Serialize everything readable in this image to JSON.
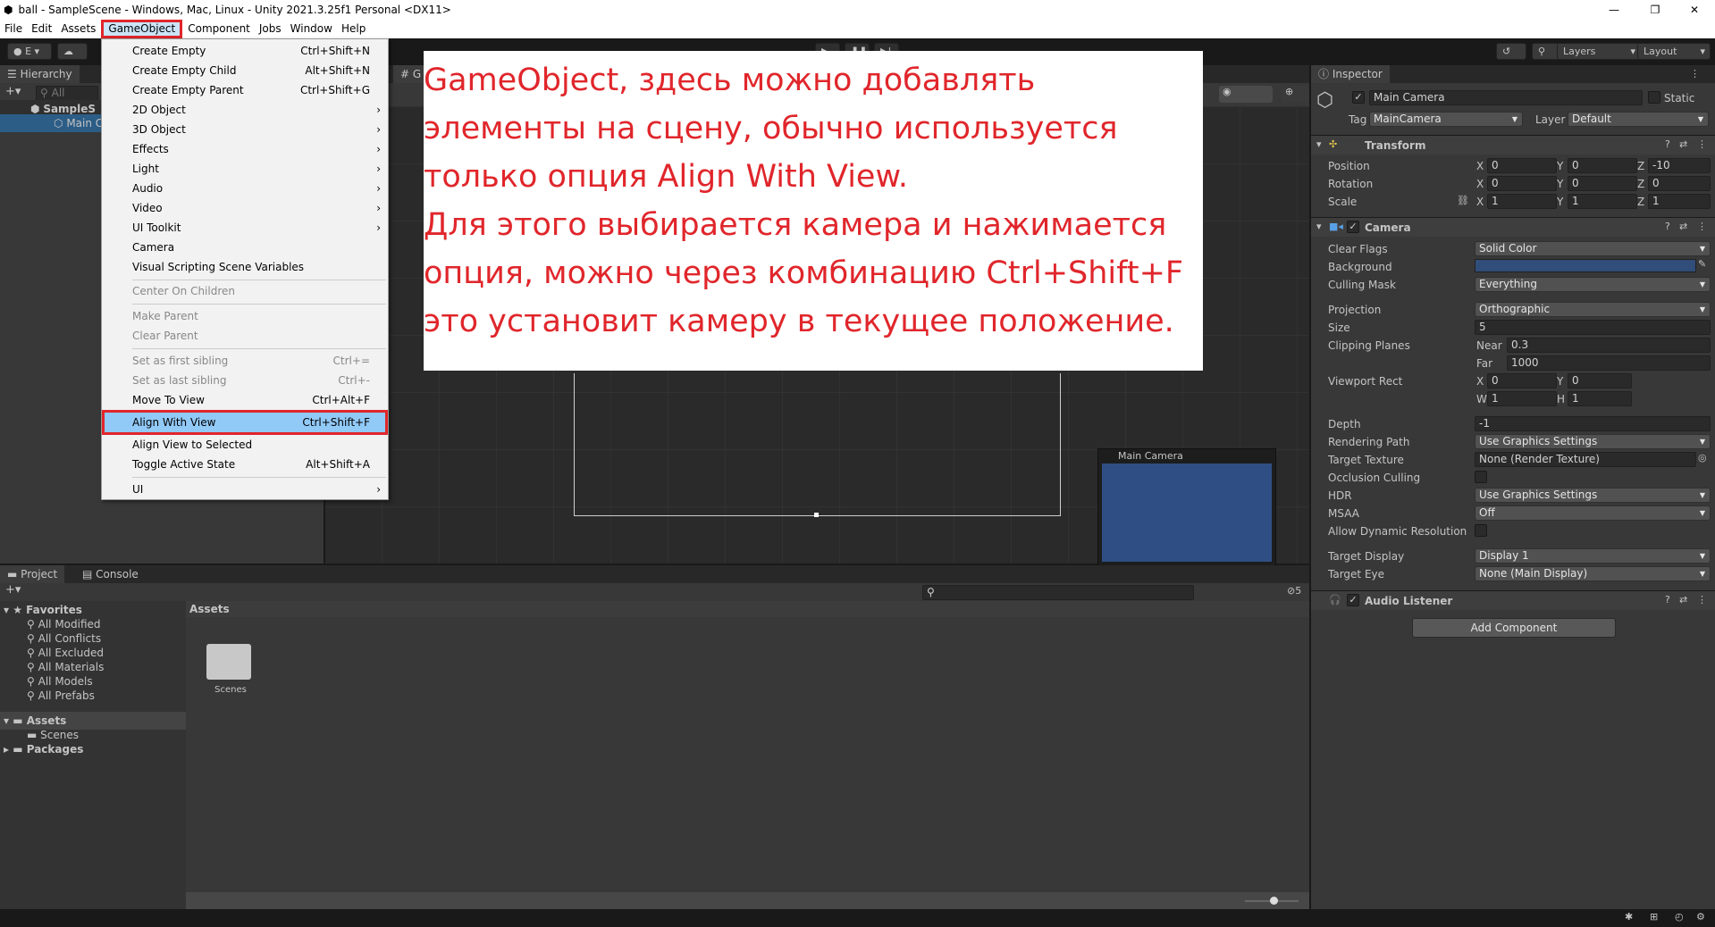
{
  "window": {
    "title": "ball - SampleScene - Windows, Mac, Linux - Unity 2021.3.25f1 Personal <DX11>",
    "minimize": "—",
    "maximize": "❐",
    "close": "✕"
  },
  "menubar": [
    "File",
    "Edit",
    "Assets",
    "GameObject",
    "Component",
    "Jobs",
    "Window",
    "Help"
  ],
  "toolbar": {
    "account": "E",
    "layers_label": "Layers",
    "layout_label": "Layout"
  },
  "hierarchy": {
    "tab": "Hierarchy",
    "search_placeholder": "All",
    "scene": "SampleS",
    "child": "Main C"
  },
  "gameobject_menu": {
    "items": [
      {
        "label": "Create Empty",
        "shortcut": "Ctrl+Shift+N"
      },
      {
        "label": "Create Empty Child",
        "shortcut": "Alt+Shift+N"
      },
      {
        "label": "Create Empty Parent",
        "shortcut": "Ctrl+Shift+G"
      },
      {
        "label": "2D Object",
        "arrow": "›"
      },
      {
        "label": "3D Object",
        "arrow": "›"
      },
      {
        "label": "Effects",
        "arrow": "›"
      },
      {
        "label": "Light",
        "arrow": "›"
      },
      {
        "label": "Audio",
        "arrow": "›"
      },
      {
        "label": "Video",
        "arrow": "›"
      },
      {
        "label": "UI Toolkit",
        "arrow": "›"
      },
      {
        "label": "Camera"
      },
      {
        "label": "Visual Scripting Scene Variables"
      },
      {
        "label": "Center On Children"
      },
      {
        "label": "Make Parent"
      },
      {
        "label": "Clear Parent"
      },
      {
        "label": "Set as first sibling",
        "shortcut": "Ctrl+="
      },
      {
        "label": "Set as last sibling",
        "shortcut": "Ctrl+-"
      },
      {
        "label": "Move To View",
        "shortcut": "Ctrl+Alt+F"
      },
      {
        "label": "Align With View",
        "shortcut": "Ctrl+Shift+F"
      },
      {
        "label": "Align View to Selected"
      },
      {
        "label": "Toggle Active State",
        "shortcut": "Alt+Shift+A"
      },
      {
        "label": "UI",
        "arrow": "›"
      }
    ]
  },
  "annotation": {
    "lines": [
      "GameObject, здесь можно добавлять",
      "элементы на сцену, обычно используется",
      "только опция Align With View.",
      "Для этого выбирается камера и нажимается",
      "опция, можно через комбинацию Ctrl+Shift+F",
      "это установит камеру в текущее положение."
    ],
    "color": "#e0262b"
  },
  "scene_view": {
    "tab_partial": "G",
    "camera_preview_title": "Main Camera",
    "preview_color": "#2f4f84"
  },
  "inspector": {
    "tab": "Inspector",
    "object_name": "Main Camera",
    "static_label": "Static",
    "tag_label": "Tag",
    "tag_value": "MainCamera",
    "layer_label": "Layer",
    "layer_value": "Default",
    "transform": {
      "title": "Transform",
      "position_label": "Position",
      "position": [
        "0",
        "0",
        "-10"
      ],
      "rotation_label": "Rotation",
      "rotation": [
        "0",
        "0",
        "0"
      ],
      "scale_label": "Scale",
      "scale": [
        "1",
        "1",
        "1"
      ]
    },
    "camera": {
      "title": "Camera",
      "clear_flags_label": "Clear Flags",
      "clear_flags": "Solid Color",
      "background_label": "Background",
      "background_color": "#314d79",
      "culling_mask_label": "Culling Mask",
      "culling_mask": "Everything",
      "projection_label": "Projection",
      "projection": "Orthographic",
      "size_label": "Size",
      "size": "5",
      "clipping_label": "Clipping Planes",
      "near_label": "Near",
      "near": "0.3",
      "far_label": "Far",
      "far": "1000",
      "viewport_label": "Viewport Rect",
      "vx": "0",
      "vy": "0",
      "vw": "1",
      "vh": "1",
      "depth_label": "Depth",
      "depth": "-1",
      "rendering_path_label": "Rendering Path",
      "rendering_path": "Use Graphics Settings",
      "target_texture_label": "Target Texture",
      "target_texture": "None (Render Texture)",
      "occlusion_label": "Occlusion Culling",
      "hdr_label": "HDR",
      "hdr": "Use Graphics Settings",
      "msaa_label": "MSAA",
      "msaa": "Off",
      "dynres_label": "Allow Dynamic Resolution",
      "target_display_label": "Target Display",
      "target_display": "Display 1",
      "target_eye_label": "Target Eye",
      "target_eye": "None (Main Display)"
    },
    "audio_listener": "Audio Listener",
    "add_component": "Add Component"
  },
  "project": {
    "tab_project": "Project",
    "tab_console": "Console",
    "favorites": "Favorites",
    "fav_items": [
      "All Modified",
      "All Conflicts",
      "All Excluded",
      "All Materials",
      "All Models",
      "All Prefabs"
    ],
    "assets": "Assets",
    "scenes": "Scenes",
    "packages": "Packages",
    "breadcrumb": "Assets",
    "folder_label": "Scenes",
    "count": "5"
  }
}
